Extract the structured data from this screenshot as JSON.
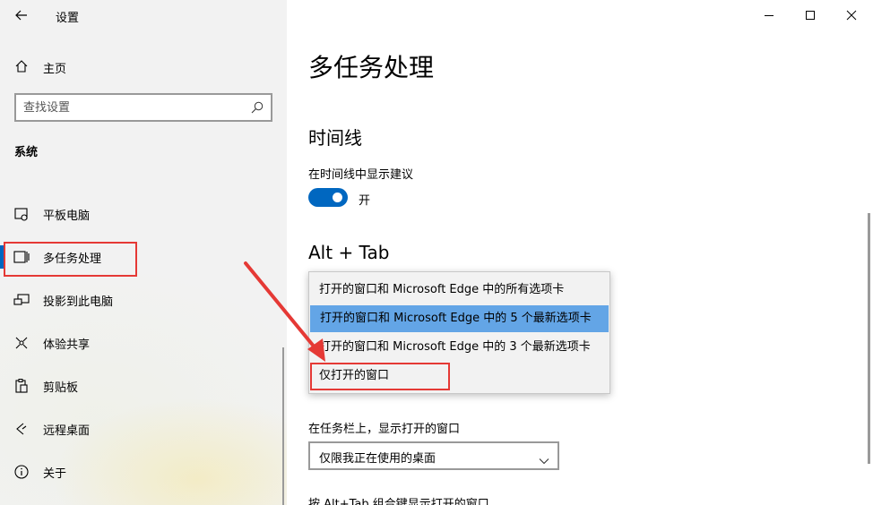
{
  "window": {
    "title": "设置"
  },
  "sidebar": {
    "home_label": "主页",
    "search_placeholder": "查找设置",
    "section_label": "系统",
    "items": [
      {
        "label": "平板电脑",
        "icon": "tablet-icon"
      },
      {
        "label": "多任务处理",
        "icon": "multitasking-icon",
        "selected": true
      },
      {
        "label": "投影到此电脑",
        "icon": "project-icon"
      },
      {
        "label": "体验共享",
        "icon": "shared-experiences-icon"
      },
      {
        "label": "剪贴板",
        "icon": "clipboard-icon"
      },
      {
        "label": "远程桌面",
        "icon": "remote-desktop-icon"
      },
      {
        "label": "关于",
        "icon": "info-icon"
      }
    ]
  },
  "main": {
    "page_title": "多任务处理",
    "timeline": {
      "heading": "时间线",
      "setting_label": "在时间线中显示建议",
      "toggle_state": "开",
      "toggle_on": true
    },
    "alt_tab": {
      "heading": "Alt + Tab",
      "options": [
        "打开的窗口和 Microsoft Edge 中的所有选项卡",
        "打开的窗口和 Microsoft Edge 中的 5 个最新选项卡",
        "打开的窗口和 Microsoft Edge 中的 3 个最新选项卡",
        "仅打开的窗口"
      ],
      "highlighted_index": 1
    },
    "taskbar": {
      "setting_label": "在任务栏上，显示打开的窗口",
      "selected_value": "仅限我正在使用的桌面"
    },
    "cut_off_label": "按 Alt+Tab 组合键显示打开的窗口"
  },
  "colors": {
    "accent": "#0067c0",
    "highlight": "#63a5e6",
    "annotation": "#e53935"
  }
}
